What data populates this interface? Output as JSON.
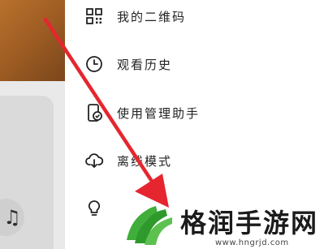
{
  "menu": {
    "items": [
      {
        "label": "我的二维码",
        "icon": "qr-code-icon"
      },
      {
        "label": "观看历史",
        "icon": "clock-icon"
      },
      {
        "label": "使用管理助手",
        "icon": "phone-check-icon"
      },
      {
        "label": "离线模式",
        "icon": "cloud-download-icon"
      },
      {
        "label": "",
        "icon": "lightbulb-icon"
      }
    ]
  },
  "background": {
    "music_icon": "music-note-icon",
    "music_glyph": "♫"
  },
  "annotation": {
    "arrow_color": "#e5262f"
  },
  "watermark": {
    "title": "格润手游网",
    "url": "www.hngrjd.com",
    "logo_color": "#3fae3a"
  }
}
